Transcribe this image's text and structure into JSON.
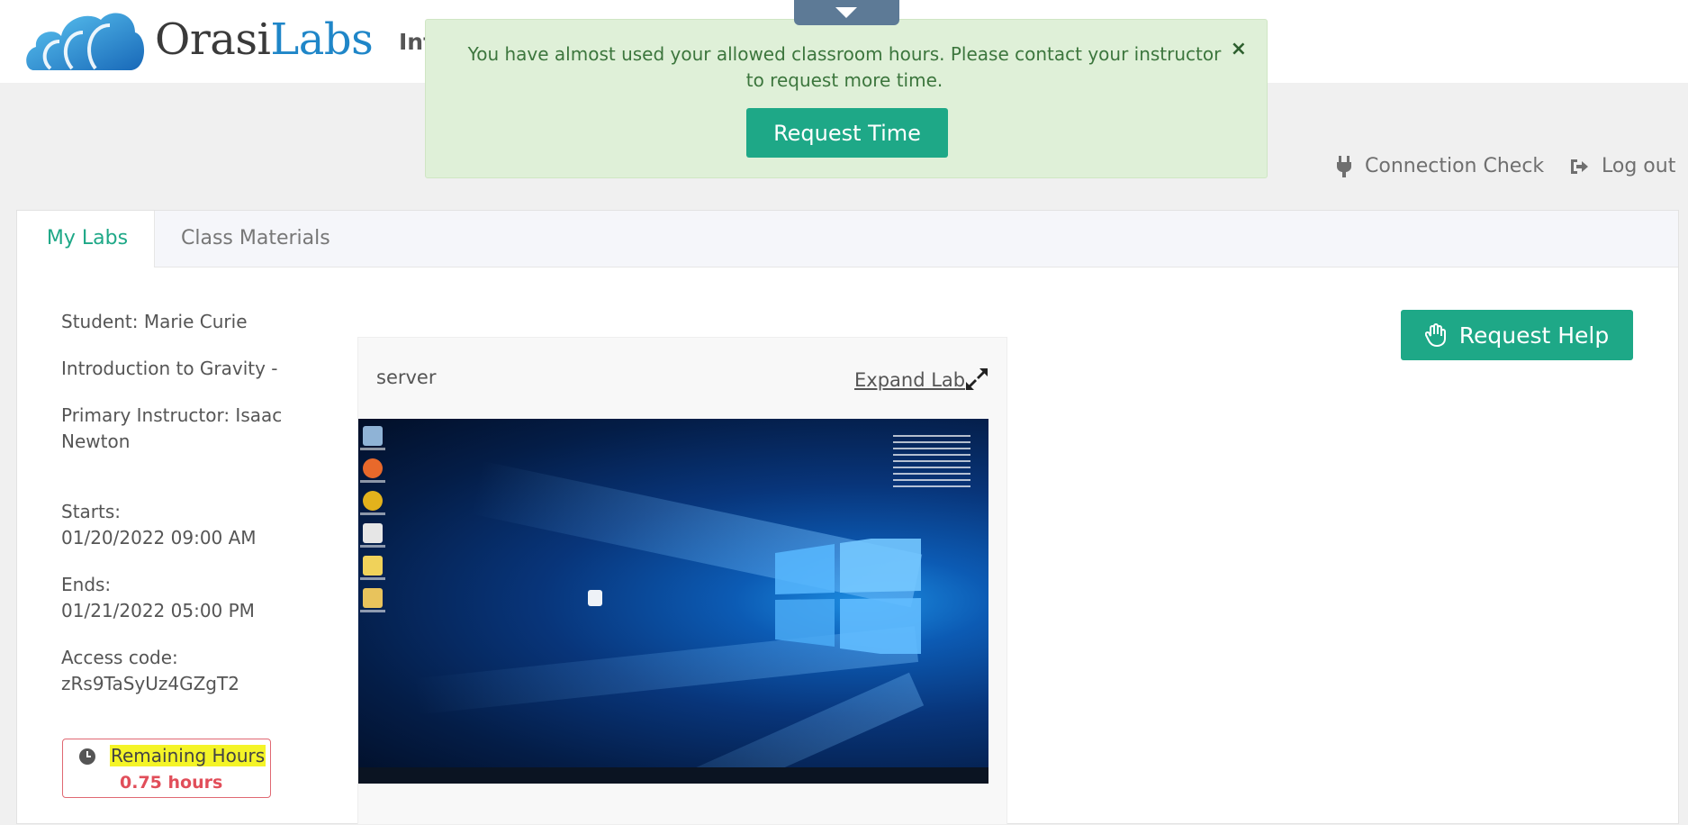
{
  "brand": {
    "name_part1": "Orasi",
    "name_part2": "Labs"
  },
  "header": {
    "course_title_partial": "Int"
  },
  "alert": {
    "message": "You have almost used your allowed classroom hours. Please contact your instructor to request more time.",
    "button_label": "Request Time",
    "close_glyph": "×"
  },
  "toplinks": {
    "connection_check": "Connection Check",
    "logout": "Log out"
  },
  "tabs": [
    {
      "label": "My Labs"
    },
    {
      "label": "Class Materials"
    }
  ],
  "info": {
    "student": "Student: Marie Curie",
    "course": "Introduction to Gravity -",
    "instructor": "Primary Instructor: Isaac Newton",
    "starts_label": "Starts:",
    "starts_value": "01/20/2022 09:00 AM",
    "ends_label": "Ends:",
    "ends_value": "01/21/2022 05:00 PM",
    "access_label": "Access code:",
    "access_value": "zRs9TaSyUz4GZgT2"
  },
  "remaining": {
    "label": "Remaining Hours",
    "value": "0.75 hours"
  },
  "lab": {
    "name": "server",
    "expand_label": "Expand Lab"
  },
  "request_help": {
    "label": "Request Help"
  },
  "colors": {
    "accent": "#1ea887",
    "alert_bg": "#dff0d8",
    "alert_text": "#3c763d",
    "danger": "#e14e5a",
    "highlight": "#f4f427"
  }
}
